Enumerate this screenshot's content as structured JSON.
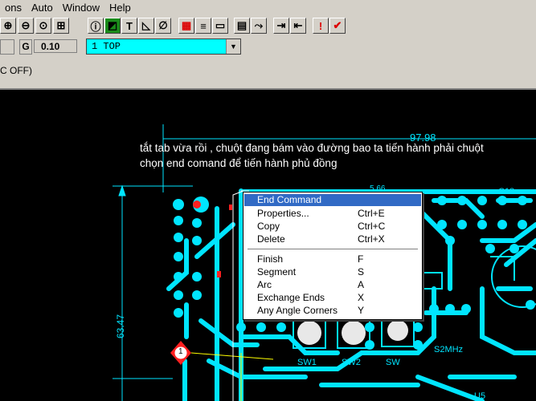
{
  "menu": {
    "items": [
      "ons",
      "Auto",
      "Window",
      "Help"
    ]
  },
  "toolbar": {
    "buttons": [
      {
        "icon": "zoom-in-icon",
        "glyph": "⊕"
      },
      {
        "icon": "zoom-out-icon",
        "glyph": "⊖"
      },
      {
        "icon": "zoom-fit-icon",
        "glyph": "⊙"
      },
      {
        "icon": "grid-icon",
        "glyph": "⊞"
      },
      {
        "icon": "info-icon",
        "glyph": "ⓘ"
      },
      {
        "icon": "pad-icon",
        "glyph": "◩"
      },
      {
        "icon": "text-icon",
        "glyph": "T"
      },
      {
        "icon": "dimension-icon",
        "glyph": "◺"
      },
      {
        "icon": "circle-icon",
        "glyph": "∅"
      },
      {
        "icon": "color-icon",
        "glyph": "▦"
      },
      {
        "icon": "drc-icon",
        "glyph": "≡"
      },
      {
        "icon": "pour-icon",
        "glyph": "▭"
      },
      {
        "icon": "flood-icon",
        "glyph": "▤"
      },
      {
        "icon": "route-icon",
        "glyph": "⤳"
      },
      {
        "icon": "split-icon",
        "glyph": "⇥"
      },
      {
        "icon": "via-icon",
        "glyph": "⇤"
      },
      {
        "icon": "align-icon",
        "glyph": "⇢"
      },
      {
        "icon": "swap-icon",
        "glyph": "↯"
      },
      {
        "icon": "verify-icon",
        "glyph": "!"
      },
      {
        "icon": "drc-check-icon",
        "glyph": "✔"
      }
    ]
  },
  "params": {
    "g_label": "G",
    "g_value": "0.10",
    "layer_value": "1 TOP"
  },
  "status": {
    "text": "C OFF)"
  },
  "canvas": {
    "overlay_line1": "tắt tab vừa rồi , chuột đang bám vào đường bao ta tiến hành phải chuột",
    "overlay_line2": "chọn end comand để tiến hành phủ đồng",
    "dim_horizontal": "97.98",
    "dim_vertical": "63.47",
    "via_label": "1",
    "top_label": "5.66",
    "part_labels": [
      "SW1",
      "SW2",
      "SW",
      "S2MHz",
      "U5",
      "C18"
    ]
  },
  "context_menu": {
    "items": [
      {
        "label": "End Command",
        "shortcut": "",
        "selected": true
      },
      {
        "label": "Properties...",
        "shortcut": "Ctrl+E"
      },
      {
        "label": "Copy",
        "shortcut": "Ctrl+C"
      },
      {
        "label": "Delete",
        "shortcut": "Ctrl+X"
      },
      {
        "label": "Finish",
        "shortcut": "F"
      },
      {
        "label": "Segment",
        "shortcut": "S"
      },
      {
        "label": "Arc",
        "shortcut": "A"
      },
      {
        "label": "Exchange Ends",
        "shortcut": "X"
      },
      {
        "label": "Any Angle Corners",
        "shortcut": "Y"
      }
    ]
  },
  "colors": {
    "trace": "#00e5ff",
    "background": "#000000",
    "highlight": "#316ac5",
    "pad_red": "#ff2020",
    "courtyard": "#ffff00"
  }
}
